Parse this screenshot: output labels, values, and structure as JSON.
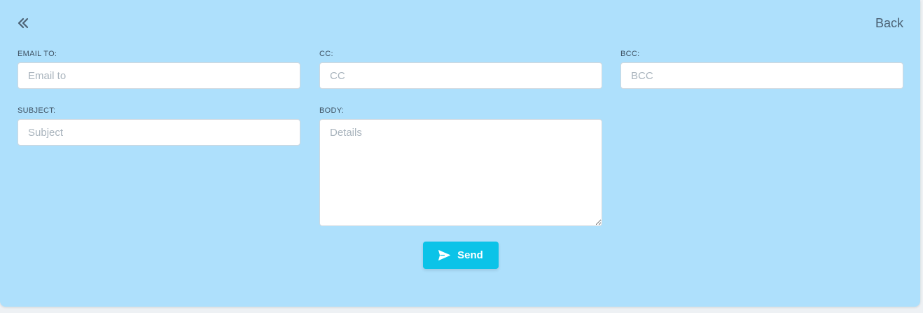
{
  "header": {
    "collapse_icon": "double-chevron-left-icon",
    "back_label": "Back"
  },
  "form": {
    "email_to": {
      "label": "EMAIL TO:",
      "placeholder": "Email to",
      "value": ""
    },
    "cc": {
      "label": "CC:",
      "placeholder": "CC",
      "value": ""
    },
    "bcc": {
      "label": "BCC:",
      "placeholder": "BCC",
      "value": ""
    },
    "subject": {
      "label": "SUBJECT:",
      "placeholder": "Subject",
      "value": ""
    },
    "body": {
      "label": "BODY:",
      "placeholder": "Details",
      "value": ""
    }
  },
  "actions": {
    "send_label": "Send",
    "send_icon": "paper-plane-icon"
  },
  "colors": {
    "panel_background": "#aee0fc",
    "send_button": "#0bc3e8",
    "label_text": "#3f5263"
  }
}
